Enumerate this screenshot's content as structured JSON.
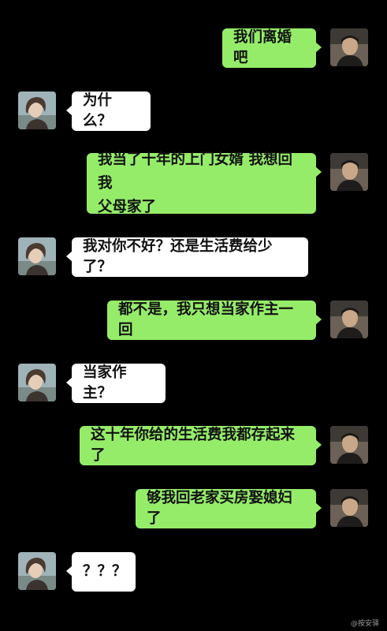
{
  "messages": [
    {
      "side": "right",
      "text": "我们离婚吧"
    },
    {
      "side": "left",
      "text": "为什么？"
    },
    {
      "side": "right",
      "text": "我当了十年的上门女婿 我想回我\n父母家了"
    },
    {
      "side": "left",
      "text": "我对你不好？还是生活费给少了？"
    },
    {
      "side": "right",
      "text": "都不是，我只想当家作主一回"
    },
    {
      "side": "left",
      "text": "当家作主？"
    },
    {
      "side": "right",
      "text": "这十年你给的生活费我都存起来了"
    },
    {
      "side": "right",
      "text": "够我回老家买房娶媳妇了"
    },
    {
      "side": "left",
      "text": "？？？"
    }
  ],
  "watermark": "@按安驿",
  "colors": {
    "background": "#000000",
    "bubble_right": "#95ec69",
    "bubble_left": "#ffffff"
  },
  "icons": {
    "right_avatar": "male-avatar-icon",
    "left_avatar": "female-avatar-icon"
  }
}
